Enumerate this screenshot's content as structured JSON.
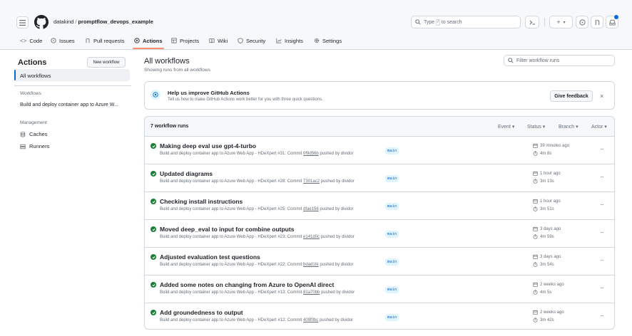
{
  "header": {
    "owner": "datakind",
    "separator": "/",
    "repo": "promptflow_devops_example",
    "search_prefix": "Type",
    "search_key": "/",
    "search_suffix": "to search"
  },
  "repo_nav": {
    "code": "Code",
    "issues": "Issues",
    "pull_requests": "Pull requests",
    "actions": "Actions",
    "projects": "Projects",
    "wiki": "Wiki",
    "security": "Security",
    "insights": "Insights",
    "settings": "Settings"
  },
  "sidebar": {
    "title": "Actions",
    "new_workflow": "New workflow",
    "all_workflows": "All workflows",
    "workflows_heading": "Workflows",
    "workflow_item": "Build and deploy container app to Azure W...",
    "management_heading": "Management",
    "caches": "Caches",
    "runners": "Runners"
  },
  "main": {
    "title": "All workflows",
    "subtitle": "Showing runs from all workflows",
    "filter_placeholder": "Filter workflow runs"
  },
  "banner": {
    "title": "Help us improve GitHub Actions",
    "subtitle": "Tell us how to make GitHub Actions work better for you with three quick questions.",
    "feedback": "Give feedback",
    "close": "×"
  },
  "runs": {
    "count": "7 workflow runs",
    "filters": [
      "Event ▾",
      "Status ▾",
      "Branch ▾",
      "Actor ▾"
    ],
    "items": [
      {
        "title": "Making deep eval use gpt-4-turbo",
        "wf": "Build and deploy container app to Azure Web App - HDeXpert #31:",
        "commit_prefix": "Commit",
        "sha": "0f9d56b",
        "by": "pushed by dividor",
        "branch": "main",
        "when": "39 minutes ago",
        "dur": "4m 8s"
      },
      {
        "title": "Updated diagrams",
        "wf": "Build and deploy container app to Azure Web App - HDeXpert #28:",
        "commit_prefix": "Commit",
        "sha": "7301ac2",
        "by": "pushed by dividor",
        "branch": "main",
        "when": "1 hour ago",
        "dur": "3m 13s"
      },
      {
        "title": "Checking install instructions",
        "wf": "Build and deploy container app to Azure Web App - HDeXpert #25:",
        "commit_prefix": "Commit",
        "sha": "dfae156",
        "by": "pushed by dividor",
        "branch": "main",
        "when": "1 hour ago",
        "dur": "3m 51s"
      },
      {
        "title": "Moved deep_eval to input for combine outputs",
        "wf": "Build and deploy container app to Azure Web App - HDeXpert #23:",
        "commit_prefix": "Commit",
        "sha": "e141d0c",
        "by": "pushed by dividor",
        "branch": "main",
        "when": "3 days ago",
        "dur": "4m 59s"
      },
      {
        "title": "Adjusted evaluation test questions",
        "wf": "Build and deploy container app to Azure Web App - HDeXpert #22:",
        "commit_prefix": "Commit",
        "sha": "bdad1fe",
        "by": "pushed by dividor",
        "branch": "main",
        "when": "3 days ago",
        "dur": "3m 54s"
      },
      {
        "title": "Added some notes on changing from Azure to OpenAI direct",
        "wf": "Build and deploy container app to Azure Web App - HDeXpert #13:",
        "commit_prefix": "Commit",
        "sha": "81a70bb",
        "by": "pushed by dividor",
        "branch": "main",
        "when": "2 weeks ago",
        "dur": "4m 5s"
      },
      {
        "title": "Add groundedness to output",
        "wf": "Build and deploy container app to Azure Web App - HDeXpert #12:",
        "commit_prefix": "Commit",
        "sha": "409f0bc",
        "by": "pushed by dividor",
        "branch": "main",
        "when": "2 weeks ago",
        "dur": "3m 42s"
      }
    ]
  },
  "colors": {
    "accent": "#0969da",
    "success": "#1a7f37",
    "nav_underline": "#fd8c73",
    "notification": "#0969da"
  },
  "icons": {
    "menu": "hamburger-icon",
    "logo": "github-logo",
    "search": "search-icon",
    "terminal": "command-palette-icon",
    "plus": "plus-icon",
    "issues": "issue-opened-icon",
    "pulls": "git-pull-request-icon",
    "inbox": "inbox-icon",
    "status": "check-circle-icon",
    "calendar": "calendar-icon",
    "stopwatch": "stopwatch-icon",
    "kebab": "kebab-horizontal-icon"
  }
}
